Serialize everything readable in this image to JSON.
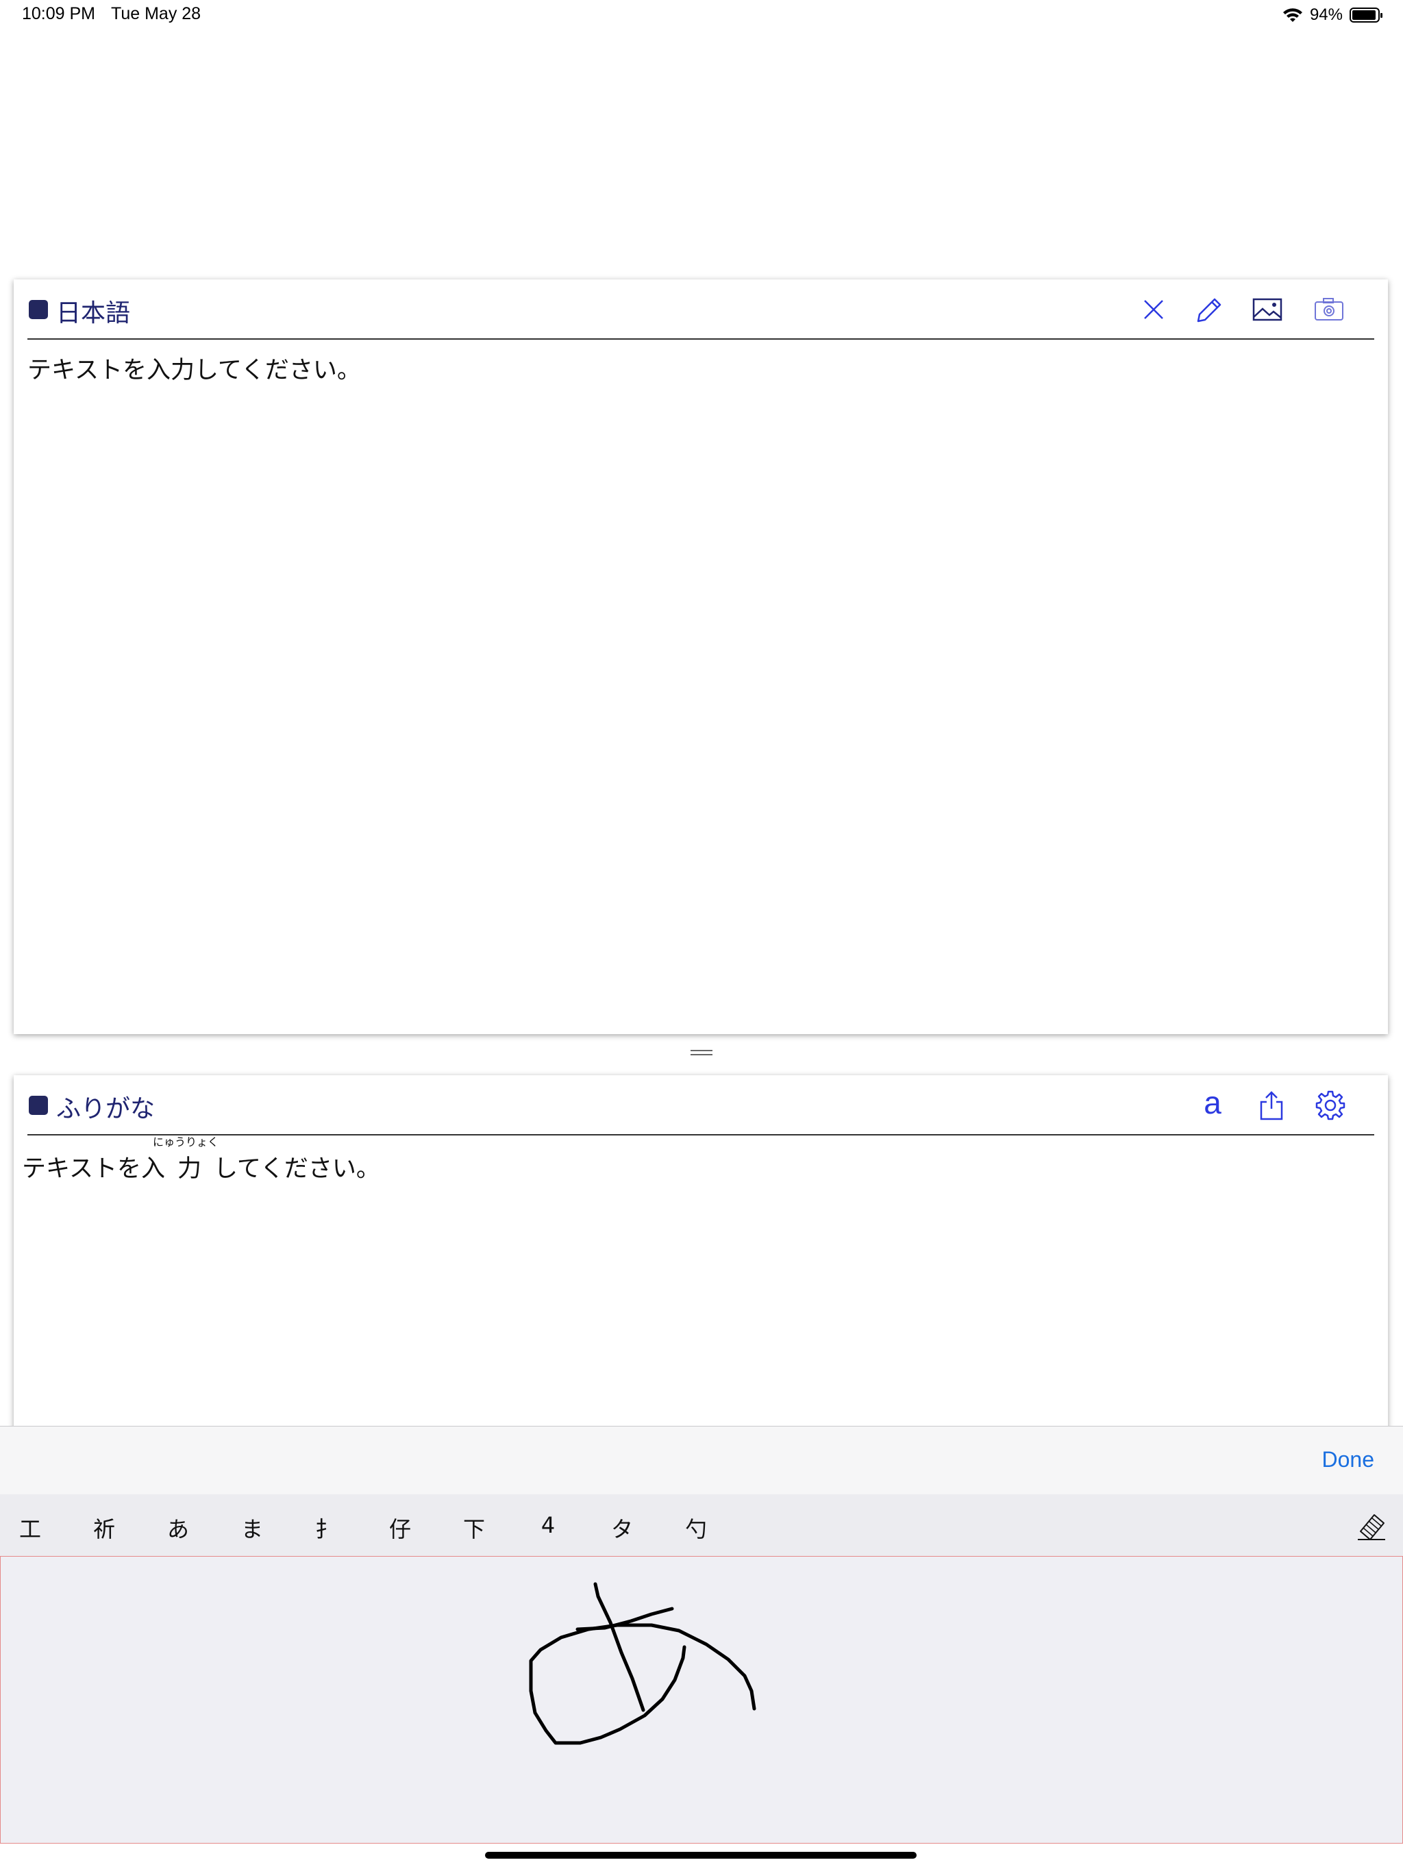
{
  "status_bar": {
    "time": "10:09 PM",
    "date": "Tue May 28",
    "battery": "94%",
    "battery_level": 0.94
  },
  "input_panel": {
    "title": "日本語",
    "text": "テキストを入力してください。",
    "icons": [
      "close-icon",
      "pencil-icon",
      "image-icon",
      "camera-icon"
    ]
  },
  "furigana_panel": {
    "title": "ふりがな",
    "text_before": "テキストを入",
    "ruby_base": "力",
    "ruby_reading": "にゅうりょく",
    "text_after": "してください。",
    "font_button": "a",
    "icons": [
      "share-icon",
      "gear-icon"
    ]
  },
  "keyboard": {
    "done_label": "Done",
    "candidates": [
      "工",
      "祈",
      "あ",
      "ま",
      "扌",
      "仔",
      "下",
      "4",
      "タ",
      "勺"
    ],
    "icons": [
      "eraser-icon"
    ],
    "accent": "#1a6fe0"
  },
  "colors": {
    "header_text": "#1f2470",
    "header_square": "#23275e",
    "icon_blue": "#2b39e0"
  }
}
